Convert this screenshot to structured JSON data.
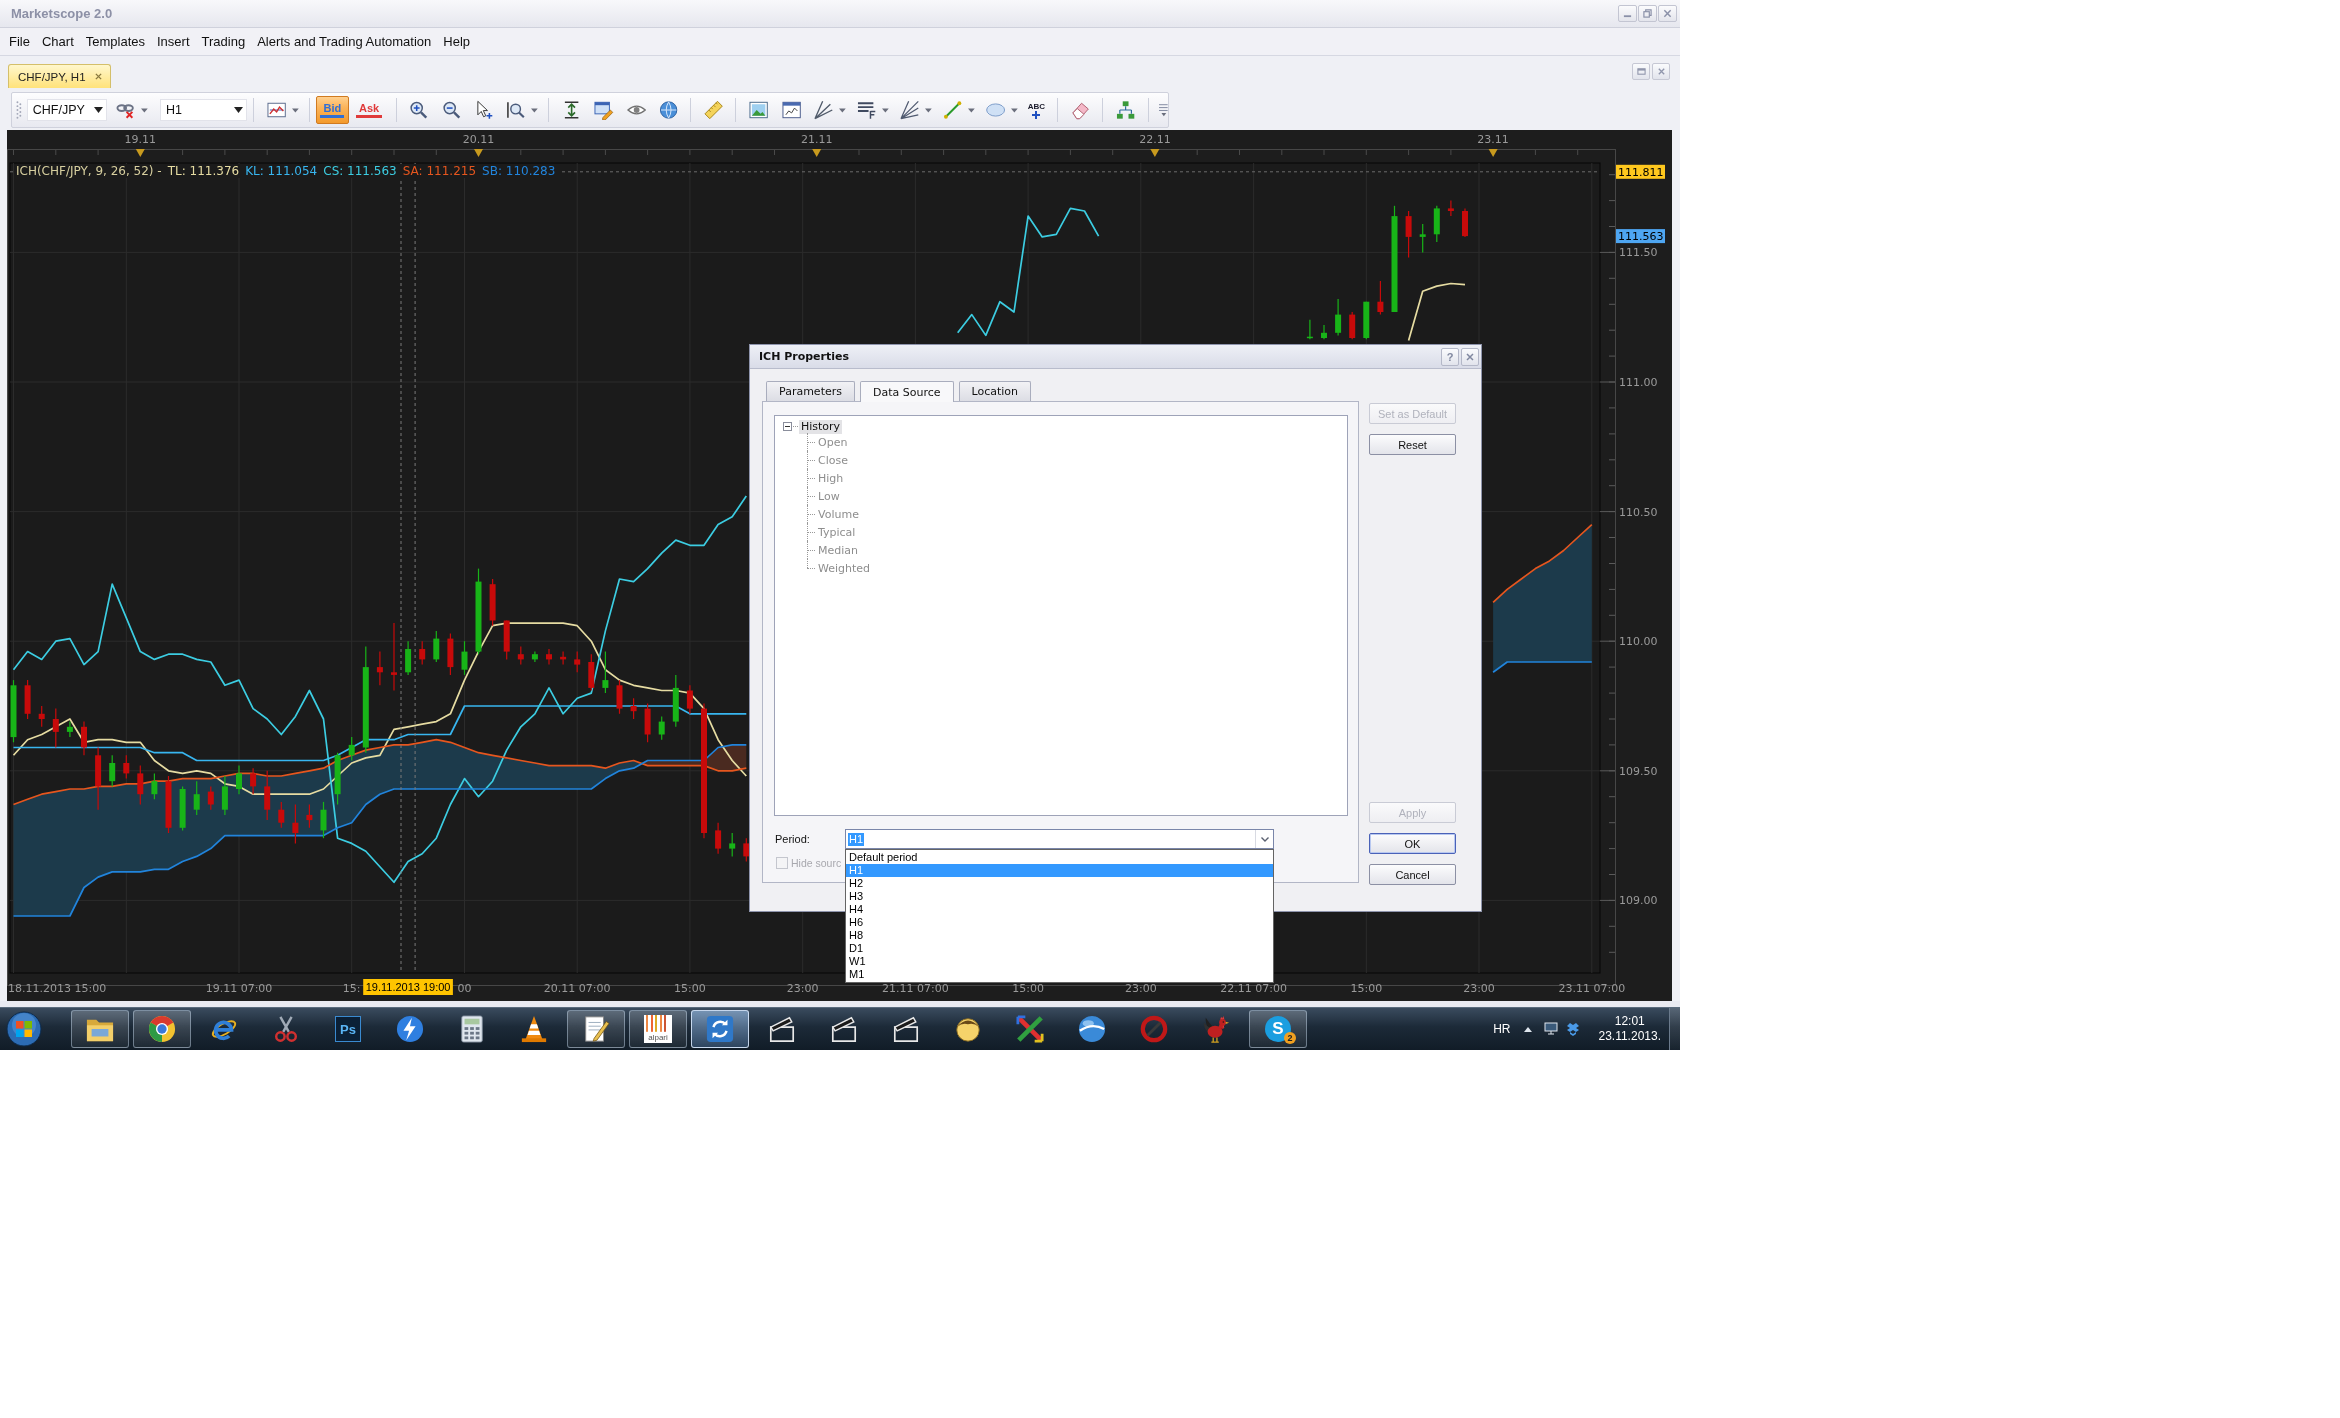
{
  "window": {
    "title": "Marketscope 2.0"
  },
  "menu": [
    "File",
    "Chart",
    "Templates",
    "Insert",
    "Trading",
    "Alerts and Trading Automation",
    "Help"
  ],
  "document_tabs": [
    {
      "label": "CHF/JPY, H1",
      "selected": true
    }
  ],
  "toolbar": {
    "symbol": "CHF/JPY",
    "period": "H1",
    "price_toggles": [
      {
        "label": "Bid",
        "selected": true,
        "color": "#2f6fd6"
      },
      {
        "label": "Ask",
        "selected": false,
        "color": "#e03a3a"
      }
    ],
    "text_tool": "ABC"
  },
  "chart": {
    "legend_title": "ICH(CHF/JPY, 9, 26, 52) -",
    "date_markers": [
      "19.11",
      "20.11",
      "21.11",
      "22.11",
      "23.11"
    ],
    "axis_tags": [
      {
        "label": "111.811",
        "color": "#ffc81e"
      },
      {
        "label": "111.563",
        "color": "#4ea6f2"
      }
    ],
    "crosshair_label": {
      "label": "19.11.2013 19:00",
      "color": "#ffc400"
    },
    "chart_data": [
      {
        "type": "candlestick",
        "grid": true,
        "x": [
          "2013-11-18T15:00",
          "2013-11-18T16:00",
          "2013-11-18T17:00",
          "2013-11-18T18:00",
          "2013-11-18T19:00",
          "2013-11-18T20:00",
          "2013-11-18T21:00",
          "2013-11-18T22:00",
          "2013-11-18T23:00",
          "2013-11-19T00:00",
          "2013-11-19T01:00",
          "2013-11-19T02:00",
          "2013-11-19T03:00",
          "2013-11-19T04:00",
          "2013-11-19T05:00",
          "2013-11-19T06:00",
          "2013-11-19T07:00",
          "2013-11-19T08:00",
          "2013-11-19T09:00",
          "2013-11-19T10:00",
          "2013-11-19T11:00",
          "2013-11-19T12:00",
          "2013-11-19T13:00",
          "2013-11-19T14:00",
          "2013-11-19T15:00",
          "2013-11-19T16:00",
          "2013-11-19T17:00",
          "2013-11-19T18:00",
          "2013-11-19T19:00",
          "2013-11-19T20:00",
          "2013-11-19T21:00",
          "2013-11-19T22:00",
          "2013-11-19T23:00",
          "2013-11-20T00:00",
          "2013-11-20T01:00",
          "2013-11-20T02:00",
          "2013-11-20T03:00",
          "2013-11-20T04:00",
          "2013-11-20T05:00",
          "2013-11-20T06:00",
          "2013-11-20T07:00",
          "2013-11-20T08:00",
          "2013-11-20T09:00",
          "2013-11-20T10:00",
          "2013-11-20T11:00",
          "2013-11-20T12:00",
          "2013-11-20T13:00",
          "2013-11-20T14:00",
          "2013-11-20T15:00",
          "2013-11-20T16:00",
          "2013-11-20T17:00",
          "2013-11-20T18:00",
          "2013-11-20T19:00",
          "2013-11-21T10:00",
          "2013-11-21T11:00",
          "2013-11-21T12:00",
          "2013-11-21T13:00",
          "2013-11-21T14:00",
          "2013-11-21T15:00",
          "2013-11-21T16:00",
          "2013-11-21T17:00",
          "2013-11-21T18:00",
          "2013-11-21T19:00",
          "2013-11-21T20:00",
          "2013-11-22T11:00",
          "2013-11-22T12:00",
          "2013-11-22T13:00",
          "2013-11-22T14:00",
          "2013-11-22T15:00",
          "2013-11-22T16:00",
          "2013-11-22T17:00",
          "2013-11-22T18:00",
          "2013-11-22T19:00",
          "2013-11-22T20:00",
          "2013-11-22T21:00",
          "2013-11-22T22:00",
          "2013-11-23T00:00",
          "2013-11-23T01:00",
          "2013-11-23T02:00",
          "2013-11-23T03:00",
          "2013-11-23T04:00",
          "2013-11-23T05:00",
          "2013-11-23T06:00",
          "2013-11-23T07:00"
        ],
        "ohlc": [
          [
            109.63,
            109.85,
            109.61,
            109.83
          ],
          [
            109.83,
            109.85,
            109.7,
            109.72
          ],
          [
            109.72,
            109.75,
            109.67,
            109.7
          ],
          [
            109.7,
            109.74,
            109.59,
            109.65
          ],
          [
            109.65,
            109.69,
            109.63,
            109.67
          ],
          [
            109.67,
            109.69,
            109.56,
            109.59
          ],
          [
            109.56,
            109.59,
            109.35,
            109.44
          ],
          [
            109.46,
            109.56,
            109.44,
            109.53
          ],
          [
            109.53,
            109.56,
            109.47,
            109.49
          ],
          [
            109.49,
            109.52,
            109.37,
            109.41
          ],
          [
            109.41,
            109.49,
            109.39,
            109.46
          ],
          [
            109.46,
            109.48,
            109.26,
            109.28
          ],
          [
            109.28,
            109.44,
            109.27,
            109.43
          ],
          [
            109.35,
            109.46,
            109.33,
            109.41
          ],
          [
            109.42,
            109.44,
            109.35,
            109.37
          ],
          [
            109.35,
            109.48,
            109.33,
            109.44
          ],
          [
            109.43,
            109.52,
            109.41,
            109.49
          ],
          [
            109.49,
            109.51,
            109.41,
            109.44
          ],
          [
            109.44,
            109.5,
            109.31,
            109.35
          ],
          [
            109.35,
            109.38,
            109.28,
            109.3
          ],
          [
            109.3,
            109.37,
            109.22,
            109.26
          ],
          [
            109.33,
            109.37,
            109.28,
            109.31
          ],
          [
            109.27,
            109.38,
            109.24,
            109.35
          ],
          [
            109.41,
            109.57,
            109.37,
            109.56
          ],
          [
            109.56,
            109.63,
            109.54,
            109.6
          ],
          [
            109.59,
            109.98,
            109.57,
            109.9
          ],
          [
            109.9,
            109.96,
            109.83,
            109.88
          ],
          [
            109.88,
            110.07,
            109.81,
            109.87
          ],
          [
            109.88,
            110.0,
            109.87,
            109.97
          ],
          [
            109.97,
            110.0,
            109.91,
            109.93
          ],
          [
            109.93,
            110.04,
            109.92,
            110.01
          ],
          [
            110.01,
            110.03,
            109.87,
            109.9
          ],
          [
            109.89,
            110.0,
            109.87,
            109.96
          ],
          [
            109.96,
            110.28,
            109.95,
            110.23
          ],
          [
            110.22,
            110.24,
            110.06,
            110.08
          ],
          [
            110.08,
            110.08,
            109.93,
            109.96
          ],
          [
            109.95,
            109.98,
            109.91,
            109.93
          ],
          [
            109.93,
            109.96,
            109.92,
            109.95
          ],
          [
            109.95,
            109.97,
            109.91,
            109.93
          ],
          [
            109.94,
            109.96,
            109.91,
            109.93
          ],
          [
            109.93,
            109.96,
            109.88,
            109.91
          ],
          [
            109.92,
            109.95,
            109.81,
            109.82
          ],
          [
            109.82,
            109.96,
            109.8,
            109.85
          ],
          [
            109.83,
            109.85,
            109.72,
            109.74
          ],
          [
            109.75,
            109.78,
            109.7,
            109.73
          ],
          [
            109.74,
            109.76,
            109.61,
            109.64
          ],
          [
            109.64,
            109.71,
            109.62,
            109.69
          ],
          [
            109.69,
            109.87,
            109.67,
            109.82
          ],
          [
            109.81,
            109.83,
            109.72,
            109.74
          ],
          [
            109.74,
            109.76,
            109.24,
            109.26
          ],
          [
            109.27,
            109.3,
            109.18,
            109.2
          ],
          [
            109.2,
            109.26,
            109.17,
            109.22
          ],
          [
            109.22,
            109.24,
            109.15,
            109.17
          ],
          null,
          null,
          null,
          null,
          null,
          null,
          null,
          null,
          null,
          null,
          null,
          [
            111.17,
            111.24,
            111.165,
            111.175
          ],
          [
            111.17,
            111.22,
            111.165,
            111.19
          ],
          [
            111.19,
            111.32,
            111.18,
            111.26
          ],
          [
            111.26,
            111.27,
            111.165,
            111.17
          ],
          [
            111.17,
            111.31,
            111.165,
            111.31
          ],
          [
            111.31,
            111.39,
            111.26,
            111.27
          ],
          [
            111.27,
            111.68,
            111.27,
            111.64
          ],
          [
            111.64,
            111.66,
            111.48,
            111.56
          ],
          [
            111.56,
            111.61,
            111.5,
            111.57
          ],
          [
            111.57,
            111.68,
            111.54,
            111.67
          ],
          [
            111.67,
            111.7,
            111.64,
            111.66
          ],
          [
            111.66,
            111.67,
            111.56,
            111.563
          ],
          null,
          null,
          null,
          null,
          null,
          null,
          null,
          null
        ],
        "series": [
          {
            "name": "TL: 111.376",
            "type": "line",
            "color": "#e6dca2",
            "values": [
              109.56,
              109.62,
              109.64,
              109.67,
              109.7,
              109.61,
              109.62,
              109.62,
              109.61,
              109.61,
              109.54,
              109.5,
              109.49,
              109.5,
              109.49,
              109.45,
              109.44,
              109.41,
              109.41,
              109.41,
              109.41,
              109.41,
              109.43,
              109.48,
              109.53,
              109.55,
              109.56,
              109.66,
              109.67,
              109.68,
              109.69,
              109.72,
              109.85,
              109.96,
              110.06,
              110.07,
              110.07,
              110.07,
              110.07,
              110.07,
              110.06,
              110.0,
              109.89,
              109.85,
              109.83,
              109.82,
              109.81,
              109.81,
              109.8,
              109.74,
              109.62,
              109.54,
              109.48,
              null,
              null,
              null,
              null,
              null,
              null,
              null,
              null,
              null,
              null,
              null,
              null,
              null,
              null,
              null,
              null,
              null,
              null,
              111.16,
              111.35,
              111.37,
              111.38,
              111.376,
              null,
              null,
              null,
              null,
              null,
              null,
              null,
              null
            ]
          },
          {
            "name": "KL: 111.054",
            "type": "line",
            "color": "#38b6f0",
            "values": [
              109.59,
              109.59,
              109.59,
              109.59,
              109.59,
              109.59,
              109.59,
              109.59,
              109.59,
              109.59,
              109.57,
              109.57,
              109.57,
              109.54,
              109.54,
              109.54,
              109.54,
              109.54,
              109.54,
              109.54,
              109.54,
              109.54,
              109.54,
              109.56,
              109.59,
              109.62,
              109.62,
              109.62,
              109.64,
              109.64,
              109.64,
              109.64,
              109.75,
              109.75,
              109.75,
              109.75,
              109.75,
              109.75,
              109.75,
              109.75,
              109.75,
              109.75,
              109.75,
              109.75,
              109.75,
              109.75,
              109.75,
              109.75,
              109.72,
              109.72,
              109.72,
              109.72,
              109.72,
              null,
              null,
              null,
              null,
              null,
              null,
              null,
              null,
              null,
              null,
              null,
              null,
              null,
              null,
              null,
              null,
              null,
              null,
              null,
              null,
              null,
              null,
              null,
              null,
              null,
              null,
              null,
              null,
              null,
              null,
              null
            ]
          },
          {
            "name": "CS: 111.563",
            "type": "line",
            "color": "#3ccde2",
            "values": [
              109.89,
              109.96,
              109.93,
              110.0,
              110.01,
              109.91,
              109.96,
              110.22,
              110.09,
              109.96,
              109.93,
              109.95,
              109.95,
              109.93,
              109.92,
              109.83,
              109.85,
              109.74,
              109.7,
              109.64,
              109.71,
              109.81,
              109.7,
              109.24,
              109.22,
              109.19,
              109.13,
              109.07,
              109.15,
              109.18,
              109.24,
              109.37,
              109.47,
              109.4,
              109.46,
              109.58,
              109.67,
              109.72,
              109.82,
              109.72,
              109.78,
              109.8,
              110.04,
              110.24,
              110.23,
              110.28,
              110.34,
              110.39,
              110.37,
              110.37,
              110.45,
              110.48,
              110.56,
              111.19,
              111.26,
              111.18,
              111.31,
              111.27,
              111.64,
              111.56,
              111.57,
              111.67,
              111.66,
              111.563,
              null,
              null,
              null,
              null,
              null,
              null,
              null,
              null,
              null,
              null,
              null,
              null,
              null,
              null,
              null,
              null,
              null,
              null,
              null,
              null
            ]
          },
          {
            "name": "SA: 111.215",
            "type": "line",
            "color": "#e6561e",
            "values": [
              109.37,
              109.39,
              109.41,
              109.42,
              109.43,
              109.43,
              109.44,
              109.44,
              109.45,
              109.45,
              109.46,
              109.46,
              109.47,
              109.47,
              109.47,
              109.48,
              109.49,
              109.49,
              109.48,
              109.48,
              109.49,
              109.5,
              109.51,
              109.54,
              109.56,
              109.58,
              109.59,
              109.6,
              109.6,
              109.61,
              109.62,
              109.61,
              109.59,
              109.57,
              109.56,
              109.55,
              109.54,
              109.53,
              109.52,
              109.52,
              109.52,
              109.52,
              109.51,
              109.53,
              109.54,
              109.52,
              109.52,
              109.52,
              109.52,
              109.52,
              109.5,
              109.5,
              109.51,
              null,
              null,
              null,
              null,
              null,
              null,
              null,
              null,
              null,
              null,
              null,
              null,
              null,
              null,
              null,
              null,
              null,
              null,
              null,
              null,
              null,
              null,
              null,
              110.15,
              110.2,
              110.24,
              110.28,
              110.31,
              110.35,
              110.4,
              110.45
            ]
          },
          {
            "name": "SB: 110.283",
            "type": "line",
            "color": "#2184dc",
            "values": [
              108.94,
              108.94,
              108.94,
              108.94,
              108.94,
              109.05,
              109.09,
              109.11,
              109.11,
              109.11,
              109.12,
              109.12,
              109.15,
              109.17,
              109.2,
              109.25,
              109.25,
              109.25,
              109.25,
              109.25,
              109.25,
              109.25,
              109.25,
              109.28,
              109.3,
              109.37,
              109.41,
              109.43,
              109.43,
              109.43,
              109.43,
              109.43,
              109.43,
              109.43,
              109.43,
              109.43,
              109.43,
              109.43,
              109.43,
              109.43,
              109.43,
              109.43,
              109.47,
              109.5,
              109.51,
              109.54,
              109.54,
              109.54,
              109.54,
              109.54,
              109.59,
              109.6,
              109.6,
              null,
              null,
              null,
              null,
              null,
              null,
              null,
              null,
              null,
              null,
              null,
              null,
              null,
              null,
              null,
              null,
              null,
              null,
              null,
              null,
              null,
              null,
              null,
              109.88,
              109.92,
              109.92,
              109.92,
              109.92,
              109.92,
              109.92,
              109.92
            ]
          }
        ],
        "xlim": [
          "2013-11-18T14:45",
          "2013-11-23T07:35"
        ],
        "ylim": [
          108.72,
          111.845
        ],
        "xticks": [
          {
            "value": "2013-11-18T15:00",
            "label": "18.11.2013 15:00"
          },
          {
            "value": "2013-11-19T07:00",
            "label": "19.11 07:00"
          },
          {
            "value": "2013-11-19T15:00",
            "label": "15:"
          },
          {
            "value": "2013-11-19T23:00",
            "label": "00"
          },
          {
            "value": "2013-11-20T07:00",
            "label": "20.11 07:00"
          },
          {
            "value": "2013-11-20T15:00",
            "label": "15:00"
          },
          {
            "value": "2013-11-20T23:00",
            "label": "23:00"
          },
          {
            "value": "2013-11-21T07:00",
            "label": "21.11 07:00"
          },
          {
            "value": "2013-11-21T15:00",
            "label": "15:00"
          },
          {
            "value": "2013-11-21T23:00",
            "label": "23:00"
          },
          {
            "value": "2013-11-22T07:00",
            "label": "22.11 07:00"
          },
          {
            "value": "2013-11-22T15:00",
            "label": "15:00"
          },
          {
            "value": "2013-11-22T23:00",
            "label": "23:00"
          },
          {
            "value": "2013-11-23T07:00",
            "label": "23.11 07:00"
          }
        ],
        "yticks": [
          {
            "value": 109,
            "label": "109.00"
          },
          {
            "value": 109.5,
            "label": "109.50"
          },
          {
            "value": 110,
            "label": "110.00"
          },
          {
            "value": 110.5,
            "label": "110.50"
          },
          {
            "value": 111,
            "label": "111.00"
          },
          {
            "value": 111.5,
            "label": "111.50"
          }
        ],
        "ref_lines": [
          {
            "axis": "y",
            "value": 111.811,
            "color": "#6c6c6c",
            "line_style": "dashed"
          },
          {
            "axis": "x",
            "value": "2013-11-19T18:30",
            "color": "#7a7a7a",
            "line_style": "dashed"
          },
          {
            "axis": "x",
            "value": "2013-11-19T19:30",
            "color": "#7a7a7a",
            "line_style": "dashed"
          }
        ]
      }
    ]
  },
  "dialog": {
    "title": "ICH Properties",
    "help_button": "?",
    "tabs": [
      {
        "label": "Parameters",
        "selected": false
      },
      {
        "label": "Data Source",
        "selected": true
      },
      {
        "label": "Location",
        "selected": false
      }
    ],
    "tree": {
      "label": "History",
      "expanded": true,
      "selected": true,
      "children": [
        {
          "label": "Open",
          "disabled": true
        },
        {
          "label": "Close",
          "disabled": true
        },
        {
          "label": "High",
          "disabled": true
        },
        {
          "label": "Low",
          "disabled": true
        },
        {
          "label": "Volume",
          "disabled": true
        },
        {
          "label": "Typical",
          "disabled": true
        },
        {
          "label": "Median",
          "disabled": true
        },
        {
          "label": "Weighted",
          "disabled": true
        }
      ]
    },
    "period": {
      "label": "Period:",
      "value": "H1",
      "focused": true,
      "open": true,
      "options": [
        {
          "label": "Default period",
          "selected": false
        },
        {
          "label": "H1",
          "selected": true
        },
        {
          "label": "H2",
          "selected": false
        },
        {
          "label": "H3",
          "selected": false
        },
        {
          "label": "H4",
          "selected": false
        },
        {
          "label": "H6",
          "selected": false
        },
        {
          "label": "H8",
          "selected": false
        },
        {
          "label": "D1",
          "selected": false
        },
        {
          "label": "W1",
          "selected": false
        },
        {
          "label": "M1",
          "selected": false
        }
      ]
    },
    "hide_source": {
      "label": "Hide sourc",
      "checked": false,
      "disabled": true
    },
    "buttons_top": [
      {
        "label": "Set as Default",
        "disabled": true,
        "default": false
      },
      {
        "label": "Reset",
        "disabled": false,
        "default": false
      }
    ],
    "buttons_bottom": [
      {
        "label": "Apply",
        "disabled": true,
        "default": false
      },
      {
        "label": "OK",
        "disabled": false,
        "default": true
      },
      {
        "label": "Cancel",
        "disabled": false,
        "default": false
      }
    ]
  },
  "taskbar": {
    "apps": [
      {
        "kind": "folder",
        "running": true,
        "selected": false
      },
      {
        "kind": "browser",
        "running": true,
        "selected": false
      },
      {
        "kind": "ie",
        "running": false,
        "selected": false
      },
      {
        "kind": "snip",
        "running": false,
        "selected": false
      },
      {
        "kind": "ps",
        "label": "Ps",
        "running": false,
        "selected": false
      },
      {
        "kind": "bolt",
        "running": false,
        "selected": false
      },
      {
        "kind": "calculator",
        "running": false,
        "selected": false
      },
      {
        "kind": "cone",
        "running": false,
        "selected": false
      },
      {
        "kind": "notepad",
        "running": true,
        "selected": false
      },
      {
        "kind": "alpari",
        "label": "alpari",
        "running": true,
        "selected": false
      },
      {
        "kind": "sync",
        "running": true,
        "selected": true
      },
      {
        "kind": "clapper",
        "running": false,
        "selected": false
      },
      {
        "kind": "clapper",
        "running": false,
        "selected": false
      },
      {
        "kind": "clapper",
        "running": false,
        "selected": false
      },
      {
        "kind": "mascot",
        "running": false,
        "selected": false
      },
      {
        "kind": "cross",
        "running": false,
        "selected": false
      },
      {
        "kind": "sphere",
        "running": false,
        "selected": false
      },
      {
        "kind": "ring",
        "running": false,
        "selected": false
      },
      {
        "kind": "bird",
        "running": false,
        "selected": false
      },
      {
        "kind": "skype",
        "label": "S",
        "badge": "2",
        "running": true,
        "selected": false
      }
    ],
    "language": "HR",
    "time": "12:01",
    "date": "23.11.2013."
  }
}
